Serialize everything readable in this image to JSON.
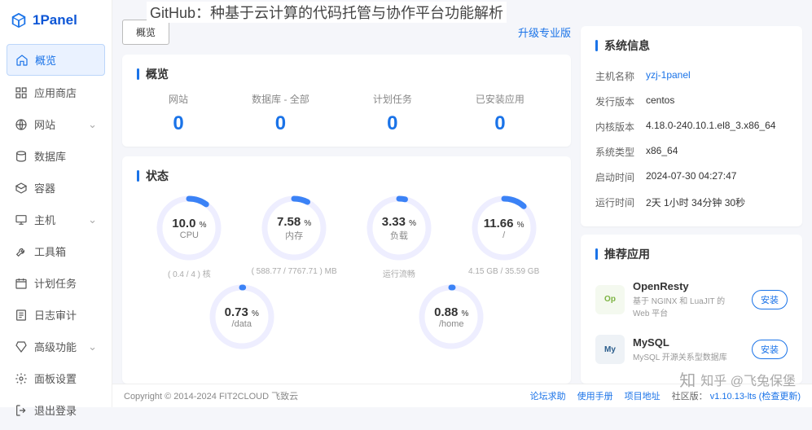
{
  "page_heading": "GitHub：种基于云计算的代码托管与协作平台功能解析",
  "logo": "1Panel",
  "sidebar": {
    "items": [
      {
        "label": "概览",
        "icon": "home"
      },
      {
        "label": "应用商店",
        "icon": "grid"
      },
      {
        "label": "网站",
        "icon": "globe",
        "chevron": true
      },
      {
        "label": "数据库",
        "icon": "db"
      },
      {
        "label": "容器",
        "icon": "box"
      },
      {
        "label": "主机",
        "icon": "host",
        "chevron": true
      },
      {
        "label": "工具箱",
        "icon": "tool"
      },
      {
        "label": "计划任务",
        "icon": "cal"
      },
      {
        "label": "日志审计",
        "icon": "log"
      },
      {
        "label": "高级功能",
        "icon": "gem",
        "chevron": true
      },
      {
        "label": "面板设置",
        "icon": "gear"
      },
      {
        "label": "退出登录",
        "icon": "exit"
      }
    ]
  },
  "header": {
    "tab": "概览",
    "upgrade": "升级专业版"
  },
  "overview": {
    "title": "概览",
    "stats": [
      {
        "label": "网站",
        "value": "0"
      },
      {
        "label": "数据库 - 全部",
        "value": "0"
      },
      {
        "label": "计划任务",
        "value": "0"
      },
      {
        "label": "已安装应用",
        "value": "0"
      }
    ]
  },
  "status": {
    "title": "状态",
    "gauges": [
      {
        "pct": "10.0",
        "unit": "%",
        "label": "CPU",
        "sub": "( 0.4 / 4 ) 核",
        "pctnum": 10
      },
      {
        "pct": "7.58",
        "unit": "%",
        "label": "内存",
        "sub": "( 588.77 / 7767.71 ) MB",
        "pctnum": 7.58
      },
      {
        "pct": "3.33",
        "unit": "%",
        "label": "负载",
        "sub": "运行流畅",
        "pctnum": 3.33
      },
      {
        "pct": "11.66",
        "unit": "%",
        "label": "/",
        "sub": "4.15 GB / 35.59 GB",
        "pctnum": 11.66
      },
      {
        "pct": "0.73",
        "unit": "%",
        "label": "/data",
        "sub": "",
        "pctnum": 0.73
      },
      {
        "pct": "0.88",
        "unit": "%",
        "label": "/home",
        "sub": "",
        "pctnum": 0.88
      }
    ]
  },
  "sysinfo": {
    "title": "系统信息",
    "rows": [
      {
        "label": "主机名称",
        "value": "yzj-1panel",
        "link": true
      },
      {
        "label": "发行版本",
        "value": "centos"
      },
      {
        "label": "内核版本",
        "value": "4.18.0-240.10.1.el8_3.x86_64"
      },
      {
        "label": "系统类型",
        "value": "x86_64"
      },
      {
        "label": "启动时间",
        "value": "2024-07-30 04:27:47"
      },
      {
        "label": "运行时间",
        "value": "2天 1小时 34分钟 30秒"
      }
    ]
  },
  "recapps": {
    "title": "推荐应用",
    "items": [
      {
        "name": "OpenResty",
        "desc": "基于 NGINX 和 LuaJIT 的 Web 平台",
        "btn": "安装",
        "color": "#7cb342"
      },
      {
        "name": "MySQL",
        "desc": "MySQL 开源关系型数据库",
        "btn": "安装",
        "color": "#2b5d8c"
      }
    ]
  },
  "footer": {
    "copyright": "Copyright © 2014-2024 FIT2CLOUD 飞致云",
    "links": [
      "论坛求助",
      "使用手册",
      "项目地址"
    ],
    "version_label": "社区版：",
    "version": "v1.10.13-lts",
    "check": "(检查更新)"
  },
  "watermark": "知乎 @飞兔保堡"
}
